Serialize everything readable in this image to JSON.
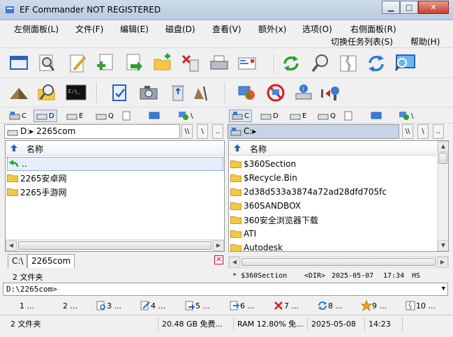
{
  "window": {
    "title": "EF Commander NOT REGISTERED"
  },
  "menu": {
    "row1": [
      "左侧面板(L)",
      "文件(F)",
      "编辑(E)",
      "磁盘(D)",
      "查看(V)",
      "额外(x)",
      "选项(O)",
      "右侧面板(R)"
    ],
    "row2": [
      "切换任务列表(S)",
      "帮助(H)"
    ]
  },
  "toolbar1": [
    "window-icon",
    "search-icon",
    "edit-icon",
    "new-file-icon",
    "copy-icon",
    "new-folder-icon",
    "delete-icon",
    "print-icon",
    "email-icon",
    "refresh-icon",
    "find-icon",
    "compare-icon",
    "sync-icon",
    "monitor-icon"
  ],
  "toolbar2": [
    "pyramid-icon",
    "folder-search-icon",
    "console-icon",
    "checklist-icon",
    "camera-icon",
    "recycle-icon",
    "wizard-icon",
    "network-icon",
    "no-network-icon",
    "disk-info-icon",
    "split-icon"
  ],
  "left": {
    "drives": [
      "C",
      "D",
      "E",
      "Q",
      "",
      "",
      "\\"
    ],
    "active_drive": "D",
    "path": "D:▸  2265com",
    "col_name": "名称",
    "items": [
      "..",
      "2265安卓网",
      "2265手游网"
    ],
    "tab_root": "C:\\",
    "tab_name": "2265com",
    "status": "2 文件夹"
  },
  "right": {
    "drives": [
      "C",
      "D",
      "E",
      "Q",
      "",
      "",
      "\\"
    ],
    "active_drive": "C",
    "path": "C:▸",
    "col_name": "名称",
    "items": [
      "$360Section",
      "$Recycle.Bin",
      "2d38d533a3874a72ad28dfd705fc",
      "360SANDBOX",
      "360安全浏览器下载",
      "ATI",
      "Autodesk"
    ],
    "status": {
      "name": "* $360Section",
      "type": "<DIR>",
      "date": "2025-05-07",
      "time": "17:34",
      "attr": "HS"
    }
  },
  "path_buttons": [
    "\\\\",
    "\\",
    ".."
  ],
  "cmdline": "D:\\2265com>",
  "fkeys": [
    "1 ...",
    "2 ...",
    "3 ...",
    "4 ...",
    "5 ...",
    "6 ...",
    "7 ...",
    "8 ...",
    "9 ...",
    "10 ..."
  ],
  "statusbar": {
    "folders": "2 文件夹",
    "free": "20.48 GB 免费...",
    "ram": "RAM 12.80% 免...",
    "date": "2025-05-08",
    "time": "14:23"
  }
}
